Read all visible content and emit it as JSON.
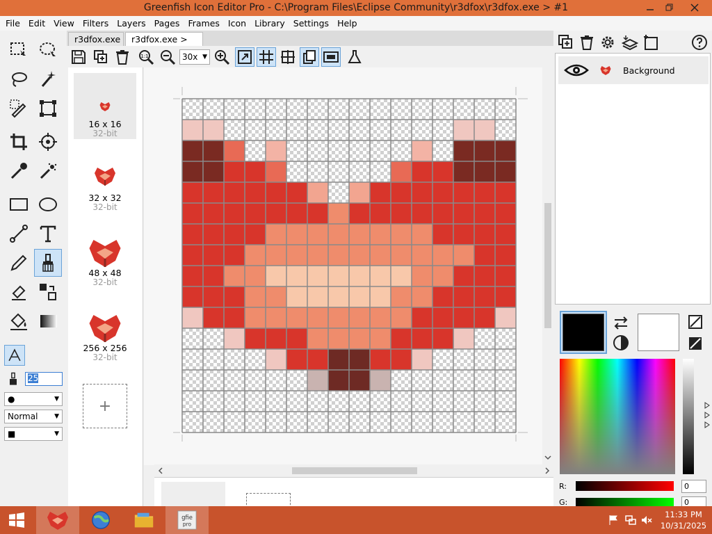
{
  "window": {
    "title": "Greenfish Icon Editor Pro - C:\\Program Files\\Eclipse Community\\r3dfox\\r3dfox.exe > #1",
    "controls": [
      "minimize-icon",
      "maximize-icon",
      "close-icon"
    ]
  },
  "menu": [
    "File",
    "Edit",
    "View",
    "Filters",
    "Layers",
    "Pages",
    "Frames",
    "Icon",
    "Library",
    "Settings",
    "Help"
  ],
  "tools": {
    "brush_size": "25",
    "brush_shape_selected": "●",
    "blend_mode_selected": "Normal",
    "fill_style_selected": "■"
  },
  "document": {
    "tabs": [
      "r3dfox.exe",
      "r3dfox.exe > #1"
    ],
    "zoom_selected": "30x"
  },
  "pages": [
    {
      "size": "16 x 16",
      "depth": "32-bit",
      "selected": true
    },
    {
      "size": "32 x 32",
      "depth": "32-bit",
      "selected": false
    },
    {
      "size": "48 x 48",
      "depth": "32-bit",
      "selected": false
    },
    {
      "size": "256 x 256",
      "depth": "32-bit",
      "selected": false
    }
  ],
  "add_page_symbol": "+",
  "layers": [
    {
      "name": "Background",
      "visible": true
    }
  ],
  "color": {
    "primary": "#000000",
    "secondary": "#ffffff",
    "r_label": "R:",
    "g_label": "G:",
    "r_value": "0",
    "g_value": "0"
  },
  "canvas": {
    "grid_size": 16,
    "pixels": [
      "................",
      "pp...........pp.",
      "DDl.m......m.DDD",
      "DDRRl.....lRRDDD",
      "RRRRRRi.iRRRRRRR",
      "RRRRRRRoRRRRRRRR",
      "RRRRooooooooRRRR",
      "RRRoooooooooooRR",
      "RRoocccccccooRRR",
      "RRRoocccccooRRRR",
      "pRRooooooooRRRRp",
      "..pRRRooooRRRp..",
      "....pRRkkRRp....",
      "......gkkg......",
      "................",
      "................"
    ],
    "palette": {
      "D": "#7a2a22",
      "R": "#d8352b",
      "r": "#e8473a",
      "o": "#ef8c6c",
      "c": "#f8c8aa",
      "l": "#e86a55",
      "m": "#f3b3a5",
      "p": "#f0c7c0",
      "i": "#f2a590",
      "k": "#6e2a24",
      "g": "#c9b3b0"
    }
  },
  "taskbar": {
    "time": "11:33 PM",
    "date": "10/31/2025"
  }
}
